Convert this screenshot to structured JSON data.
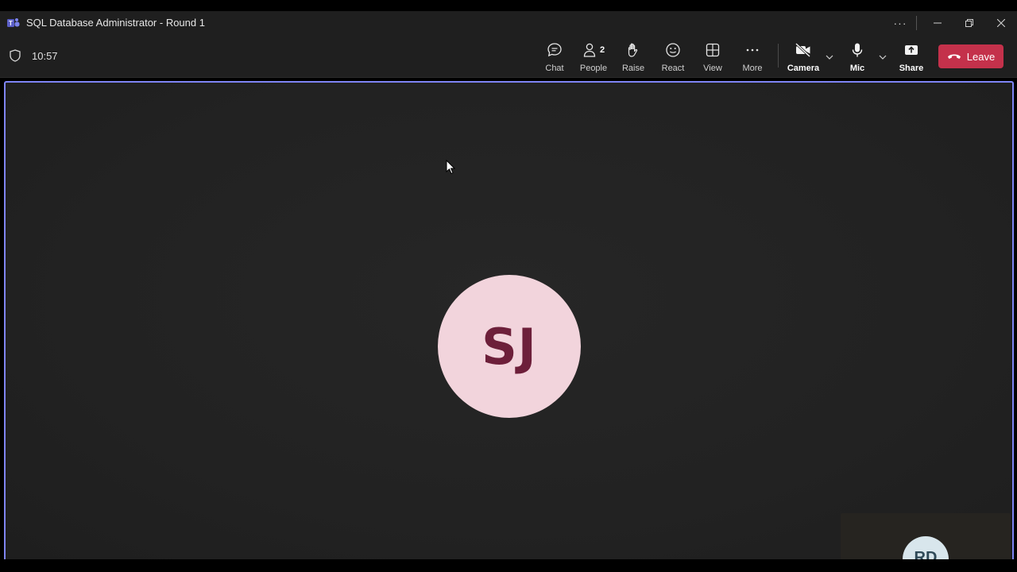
{
  "window": {
    "title": "SQL Database Administrator - Round 1",
    "more_glyph": "···"
  },
  "meeting": {
    "timer": "10:57"
  },
  "toolbar": {
    "chat_label": "Chat",
    "people_label": "People",
    "people_count": "2",
    "raise_label": "Raise",
    "react_label": "React",
    "view_label": "View",
    "more_label": "More",
    "camera_label": "Camera",
    "mic_label": "Mic",
    "share_label": "Share",
    "leave_label": "Leave"
  },
  "participants": {
    "main_initials": "SJ",
    "self_initials": "RD"
  },
  "colors": {
    "leave": "#c4314b",
    "active_border": "#7f85f5",
    "main_avatar_bg": "#f2d4dc",
    "main_avatar_text": "#6d1f3a"
  },
  "icons": {
    "app": "teams-icon",
    "shield": "shield-icon",
    "chat": "chat-icon",
    "people": "people-icon",
    "raise": "hand-icon",
    "react": "smile-icon",
    "view": "grid-icon",
    "more": "ellipsis-icon",
    "camera": "camera-off-icon",
    "mic": "mic-icon",
    "share": "share-icon",
    "leave": "phone-hangup-icon"
  }
}
